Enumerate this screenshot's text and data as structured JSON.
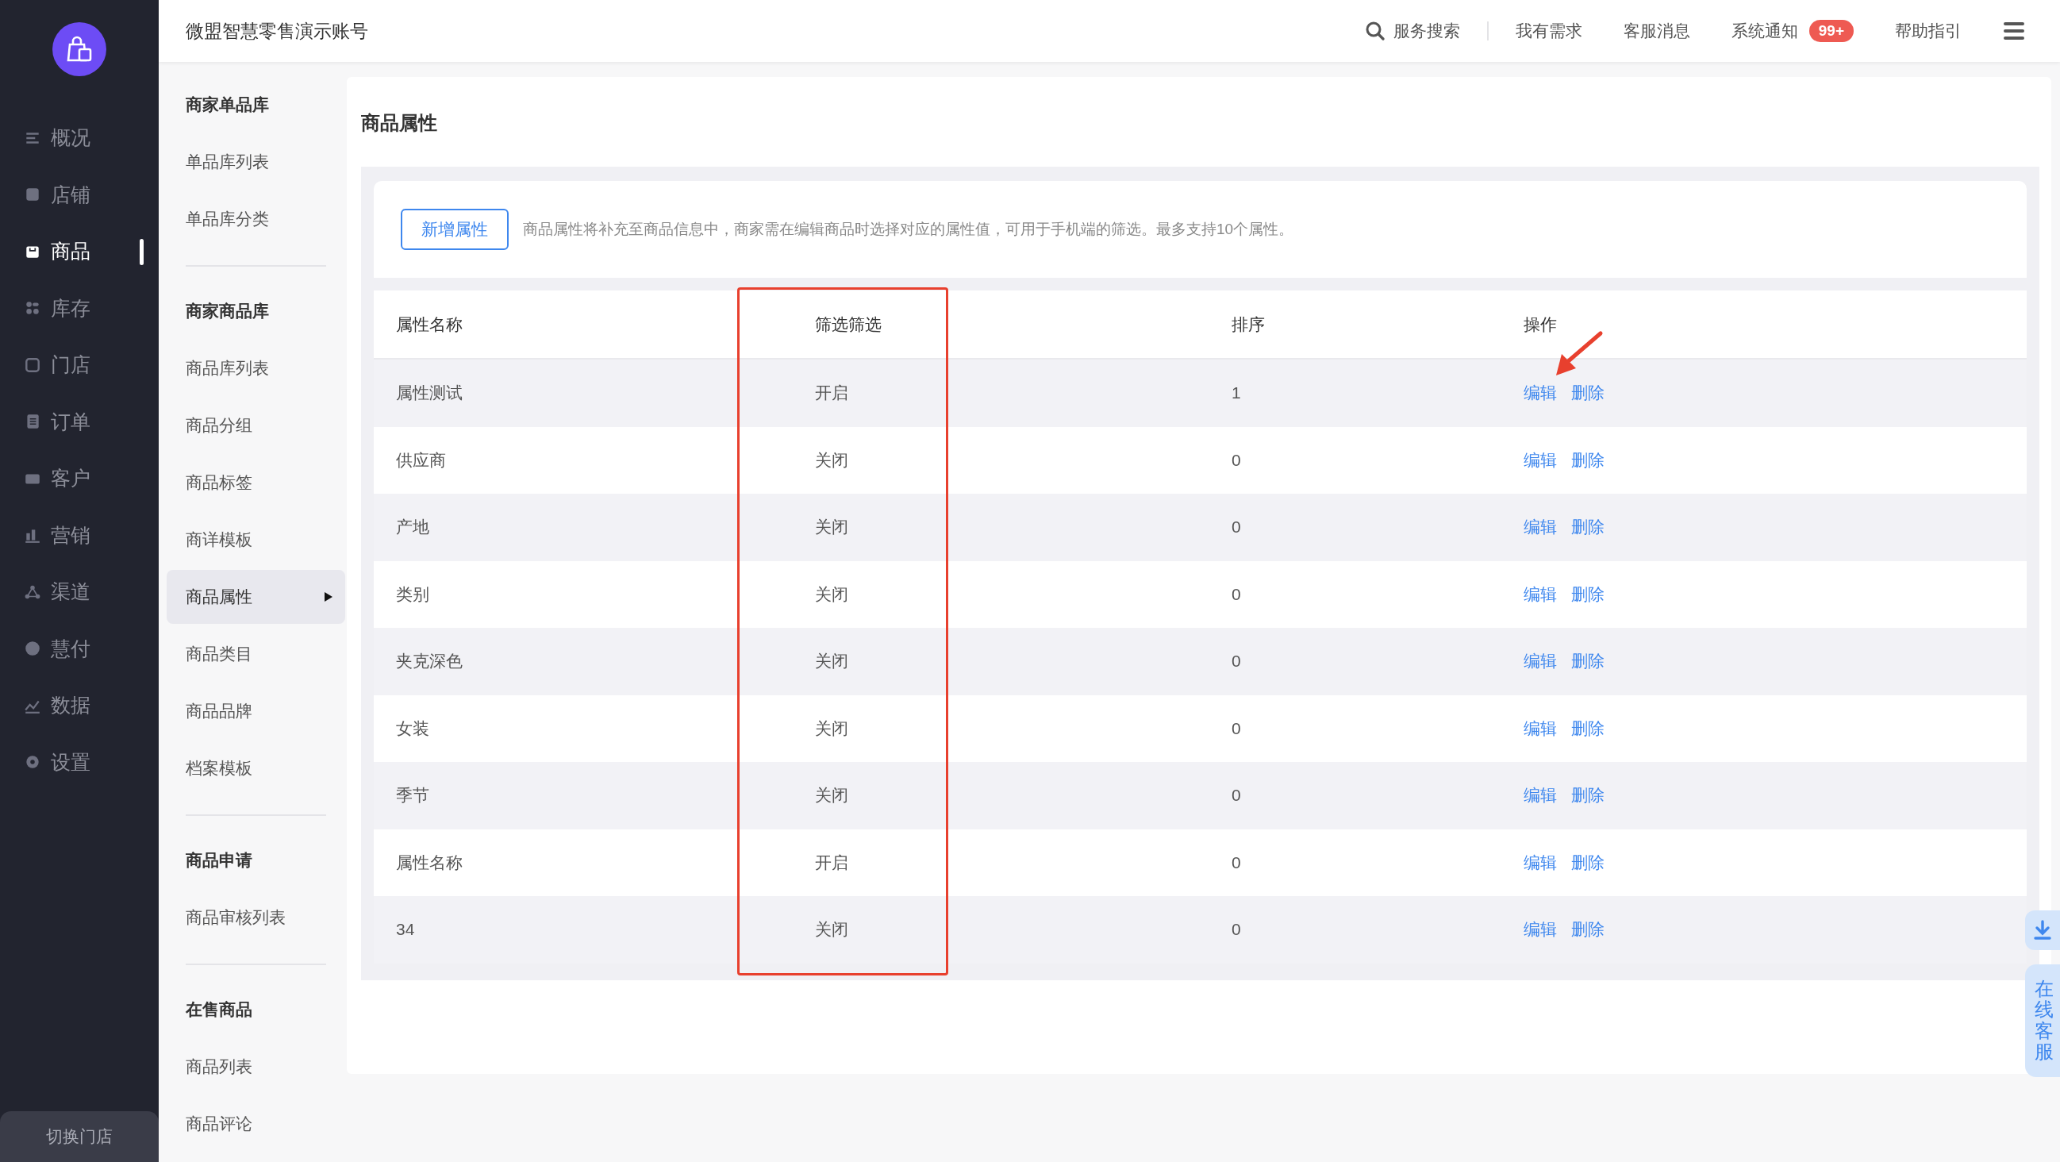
{
  "top_bar": {
    "account": "微盟智慧零售演示账号",
    "search": "服务搜索",
    "links": [
      {
        "label": "我有需求"
      },
      {
        "label": "客服消息"
      },
      {
        "label": "系统通知",
        "badge": "99+"
      },
      {
        "label": "帮助指引"
      }
    ]
  },
  "sidebar": {
    "items": [
      {
        "label": "概况",
        "selected": false
      },
      {
        "label": "店铺",
        "selected": false
      },
      {
        "label": "商品",
        "selected": true
      },
      {
        "label": "库存",
        "selected": false
      },
      {
        "label": "门店",
        "selected": false
      },
      {
        "label": "订单",
        "selected": false
      },
      {
        "label": "客户",
        "selected": false
      },
      {
        "label": "营销",
        "selected": false
      },
      {
        "label": "渠道",
        "selected": false
      },
      {
        "label": "慧付",
        "selected": false
      },
      {
        "label": "数据",
        "selected": false
      },
      {
        "label": "设置",
        "selected": false
      }
    ],
    "footer": "切换门店"
  },
  "subnav": {
    "groups": [
      {
        "title": "商家单品库",
        "items": [
          {
            "label": "单品库列表",
            "selected": false
          },
          {
            "label": "单品库分类",
            "selected": false
          }
        ]
      },
      {
        "title": "商家商品库",
        "items": [
          {
            "label": "商品库列表",
            "selected": false
          },
          {
            "label": "商品分组",
            "selected": false
          },
          {
            "label": "商品标签",
            "selected": false
          },
          {
            "label": "商详模板",
            "selected": false
          },
          {
            "label": "商品属性",
            "selected": true
          },
          {
            "label": "商品类目",
            "selected": false
          },
          {
            "label": "商品品牌",
            "selected": false
          },
          {
            "label": "档案模板",
            "selected": false
          }
        ]
      },
      {
        "title": "商品申请",
        "items": [
          {
            "label": "商品审核列表",
            "selected": false
          }
        ]
      },
      {
        "title": "在售商品",
        "items": [
          {
            "label": "商品列表",
            "selected": false
          },
          {
            "label": "商品评论",
            "selected": false
          }
        ]
      }
    ]
  },
  "page": {
    "title": "商品属性",
    "add_button": "新增属性",
    "hint": "商品属性将补充至商品信息中，商家需在编辑商品时选择对应的属性值，可用于手机端的筛选。最多支持10个属性。"
  },
  "table": {
    "columns": [
      "属性名称",
      "筛选筛选",
      "排序",
      "操作"
    ],
    "rows": [
      {
        "name": "属性测试",
        "filter": "开启",
        "sort": "1",
        "actions": [
          "编辑",
          "删除"
        ]
      },
      {
        "name": "供应商",
        "filter": "关闭",
        "sort": "0",
        "actions": [
          "编辑",
          "删除"
        ]
      },
      {
        "name": "产地",
        "filter": "关闭",
        "sort": "0",
        "actions": [
          "编辑",
          "删除"
        ]
      },
      {
        "name": "类别",
        "filter": "关闭",
        "sort": "0",
        "actions": [
          "编辑",
          "删除"
        ]
      },
      {
        "name": "夹克深色",
        "filter": "关闭",
        "sort": "0",
        "actions": [
          "编辑",
          "删除"
        ]
      },
      {
        "name": "女装",
        "filter": "关闭",
        "sort": "0",
        "actions": [
          "编辑",
          "删除"
        ]
      },
      {
        "name": "季节",
        "filter": "关闭",
        "sort": "0",
        "actions": [
          "编辑",
          "删除"
        ]
      },
      {
        "name": "属性名称",
        "filter": "开启",
        "sort": "0",
        "actions": [
          "编辑",
          "删除"
        ]
      },
      {
        "name": "34",
        "filter": "关闭",
        "sort": "0",
        "actions": [
          "编辑",
          "删除"
        ]
      }
    ]
  },
  "annotations": {
    "highlight_box": true,
    "arrow": true
  },
  "float": {
    "chat": "在线客服"
  }
}
